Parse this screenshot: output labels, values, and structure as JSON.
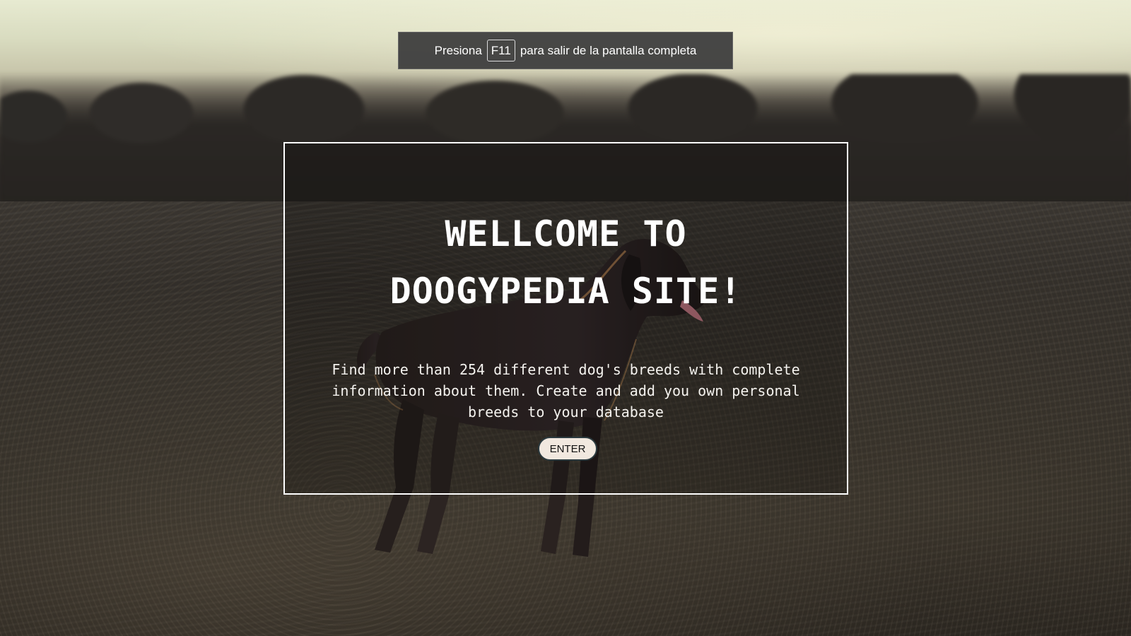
{
  "fullscreen_notice": {
    "prefix": "Presiona",
    "key": "F11",
    "suffix": "para salir de la pantalla completa"
  },
  "welcome": {
    "title_line1": "WELLCOME TO",
    "title_line2": "DOOGYPEDIA SITE!",
    "description": "Find more than 254 different dog's breeds with complete information about them. Create and add you own personal breeds to your database",
    "enter_label": "ENTER"
  },
  "colors": {
    "panel_border": "#ffffff",
    "button_bg": "#f1e8df",
    "toast_bg": "#3e3e3e"
  }
}
